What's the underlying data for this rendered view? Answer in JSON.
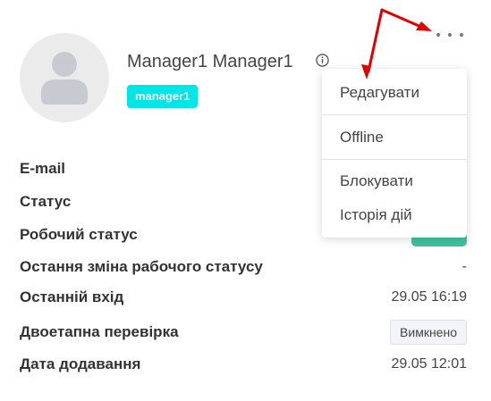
{
  "profile": {
    "name": "Manager1 Manager1",
    "role_badge": "manager1"
  },
  "details": [
    {
      "label": "E-mail",
      "value": ""
    },
    {
      "label": "Статус",
      "value": ""
    },
    {
      "label": "Робочий статус",
      "value": ""
    },
    {
      "label": "Остання зміна рабочого статусу",
      "value": "-"
    },
    {
      "label": "Останній вхід",
      "value": "29.05 16:19"
    },
    {
      "label": "Двоетапна перевірка",
      "value": "Вимкнено"
    },
    {
      "label": "Дата додавання",
      "value": "29.05 12:01"
    }
  ],
  "menu": {
    "items": [
      "Редагувати",
      "Offline",
      "Блокувати",
      "Історія дій"
    ]
  },
  "colors": {
    "role_badge": "#00e5e5",
    "status_pill": "#3cc3a0",
    "annotation_arrow": "#e00000"
  },
  "icons": {
    "info": "info-circle-icon",
    "more": "more-horizontal-icon",
    "avatar": "user-avatar-icon"
  }
}
